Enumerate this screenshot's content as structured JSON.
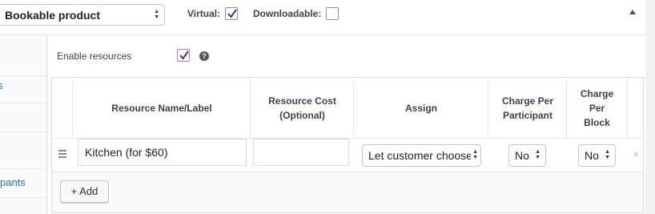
{
  "product_type": {
    "selected": "Bookable product"
  },
  "options": {
    "virtual_label": "Virtual:",
    "virtual_checked": true,
    "downloadable_label": "Downloadable:",
    "downloadable_checked": false
  },
  "sidebar": {
    "visible_item": "pants"
  },
  "resources": {
    "enable_label": "Enable resources",
    "enable_checked": true,
    "columns": [
      "Resource Name/Label",
      "Resource Cost (Optional)",
      "Assign",
      "Charge Per Participant",
      "Charge Per Block"
    ],
    "rows": [
      {
        "name": "Kitchen (for $60)",
        "cost": "",
        "assign": "Let customer choose",
        "charge_per_participant": "No",
        "charge_per_block": "No",
        "remove": "x"
      }
    ],
    "add_label": "+ Add"
  },
  "colors": {
    "accent": "#2271b1",
    "check": "#5b2a86"
  }
}
